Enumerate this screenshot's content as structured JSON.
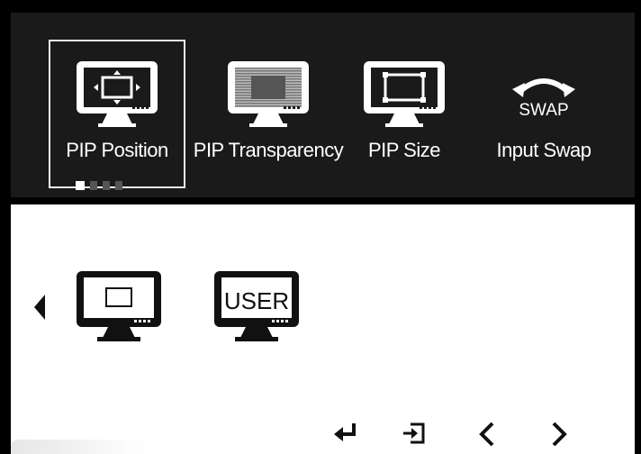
{
  "menu": {
    "items": [
      {
        "label": "PIP Position",
        "icon": "pip-position-icon",
        "selected": true
      },
      {
        "label": "PIP Transparency",
        "icon": "pip-transparency-icon",
        "selected": false
      },
      {
        "label": "PIP Size",
        "icon": "pip-size-icon",
        "selected": false
      },
      {
        "label": "Input Swap",
        "icon": "swap-icon",
        "icon_text": "SWAP",
        "selected": false
      }
    ],
    "page_indicator": {
      "current": 1,
      "total": 4
    }
  },
  "submenu": {
    "options": [
      {
        "icon": "monitor-preset-icon"
      },
      {
        "icon": "monitor-user-icon",
        "icon_text": "USER"
      }
    ]
  },
  "controls": [
    {
      "icon": "enter-icon"
    },
    {
      "icon": "exit-icon"
    },
    {
      "icon": "arrow-left-icon"
    },
    {
      "icon": "arrow-right-icon"
    }
  ],
  "colors": {
    "panel": "#1a1a1a",
    "frame": "#000000",
    "text": "#ffffff"
  }
}
